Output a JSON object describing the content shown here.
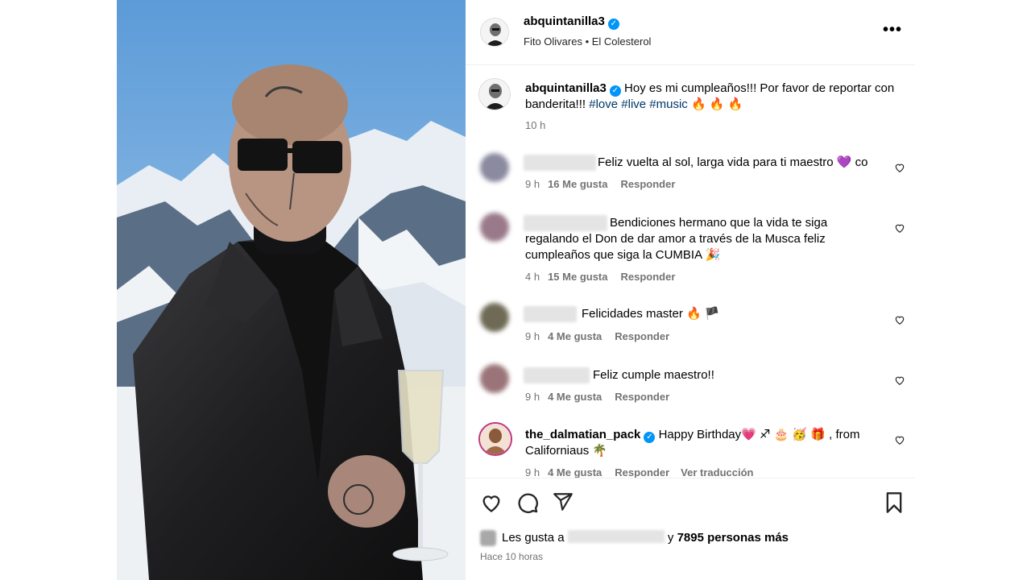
{
  "post_header": {
    "username": "abquintanilla3",
    "music": "Fito Olivares • El Colesterol",
    "more_label": "•••"
  },
  "caption": {
    "username": "abquintanilla3",
    "text": "Hoy es mi cumpleaños!!! Por favor de reportar con banderita!!!",
    "hashtags": [
      "#love",
      "#live",
      "#music"
    ],
    "emoji": "🔥 🔥 🔥",
    "time": "10 h"
  },
  "comments": [
    {
      "text": "Feliz vuelta al sol, larga vida para ti maestro 💜 co",
      "time": "9 h",
      "likes": "16 Me gusta",
      "reply": "Responder",
      "avatar_color": "#8a8aa0"
    },
    {
      "text": "Bendiciones hermano que la vida te siga regalando el Don de dar amor a través de la Musca feliz cumpleaños que siga la CUMBIA 🎉",
      "time": "4 h",
      "likes": "15 Me gusta",
      "reply": "Responder",
      "avatar_color": "#9a7a8a"
    },
    {
      "text": "Felicidades master 🔥 🏴",
      "time": "9 h",
      "likes": "4 Me gusta",
      "reply": "Responder",
      "avatar_color": "#6f6a55"
    },
    {
      "text": "Feliz cumple maestro!!",
      "time": "9 h",
      "likes": "4 Me gusta",
      "reply": "Responder",
      "avatar_color": "#9a7478"
    },
    {
      "username": "the_dalmatian_pack",
      "text": "Happy Birthday💗 ♐ 🎂 🥳 🎁 , from Californiaus 🌴",
      "time": "9 h",
      "likes": "4 Me gusta",
      "reply": "Responder",
      "translate": "Ver traducción"
    }
  ],
  "likes": {
    "prefix": "Les gusta a",
    "conjunction": "y",
    "count_text": "7895 personas más"
  },
  "time_ago": "Hace 10 horas",
  "colors": {
    "hashtag": "#00376b",
    "verified": "#0095f6",
    "secondary_text": "#737373"
  },
  "icons": [
    "verified-badge-icon",
    "more-options-icon",
    "heart-icon",
    "comment-icon",
    "share-icon",
    "bookmark-icon"
  ]
}
